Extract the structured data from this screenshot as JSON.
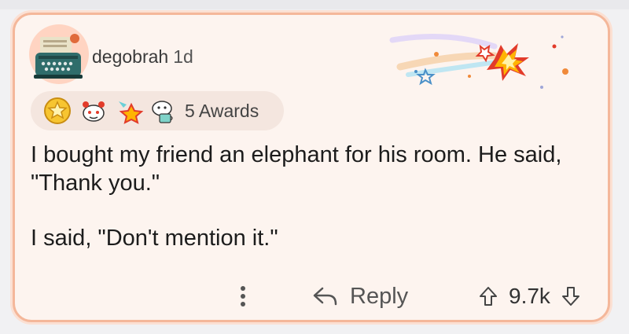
{
  "comment": {
    "author": "degobrah",
    "age": "1d",
    "awards_label": "5 Awards",
    "body": [
      "I bought my friend an elephant for his room. He said, \"Thank you.\"",
      "I said, \"Don't mention it.\""
    ]
  },
  "actions": {
    "reply_label": "Reply",
    "score": "9.7k"
  },
  "icons": {
    "avatar": "typewriter-avatar",
    "banner": "shooting-star-banner",
    "awards": [
      "gold-star-award",
      "snoo-helpful-award",
      "rocket-star-award",
      "snoo-wholesome-award"
    ],
    "more": "vertical-ellipsis-icon",
    "reply": "reply-arrow-icon",
    "upvote": "upvote-arrow-icon",
    "downvote": "downvote-arrow-icon"
  },
  "colors": {
    "card_background": "#fdf4ef",
    "card_border": "#f4b79a",
    "pill_background": "#f4e6df",
    "text": "#1c1c1c"
  }
}
